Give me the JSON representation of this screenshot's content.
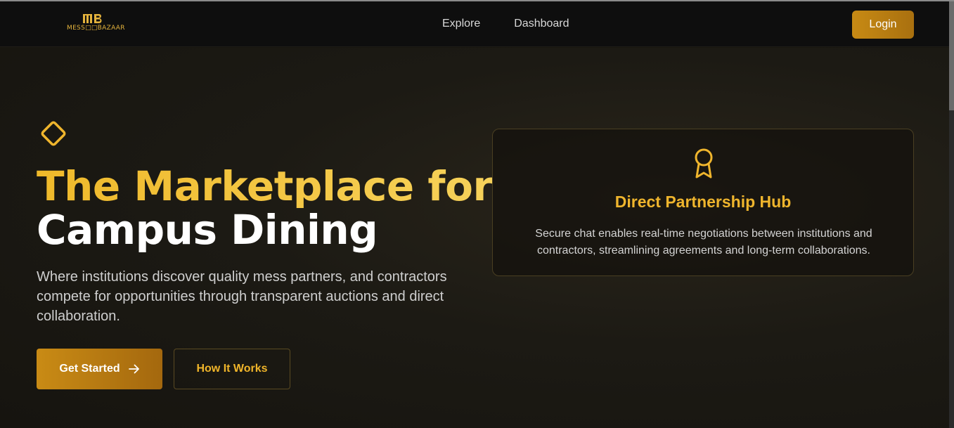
{
  "brand": {
    "logo_mark": "MB",
    "logo_text": "MESS□□BAZAAR",
    "accent_color": "#f0bf2e"
  },
  "nav": {
    "links": [
      "Explore",
      "Dashboard"
    ],
    "login_label": "Login"
  },
  "hero": {
    "headline_gold": "The Marketplace for",
    "headline_white": "Campus Dining",
    "subtext": "Where institutions discover quality mess partners, and contractors compete for opportunities through transparent auctions and direct collaboration.",
    "primary_button": "Get Started",
    "secondary_button": "How It Works"
  },
  "feature_card": {
    "icon": "award-icon",
    "title": "Direct Partnership Hub",
    "description": "Secure chat enables real-time negotiations between institutions and contractors, streamlining agreements and long-term collaborations."
  }
}
